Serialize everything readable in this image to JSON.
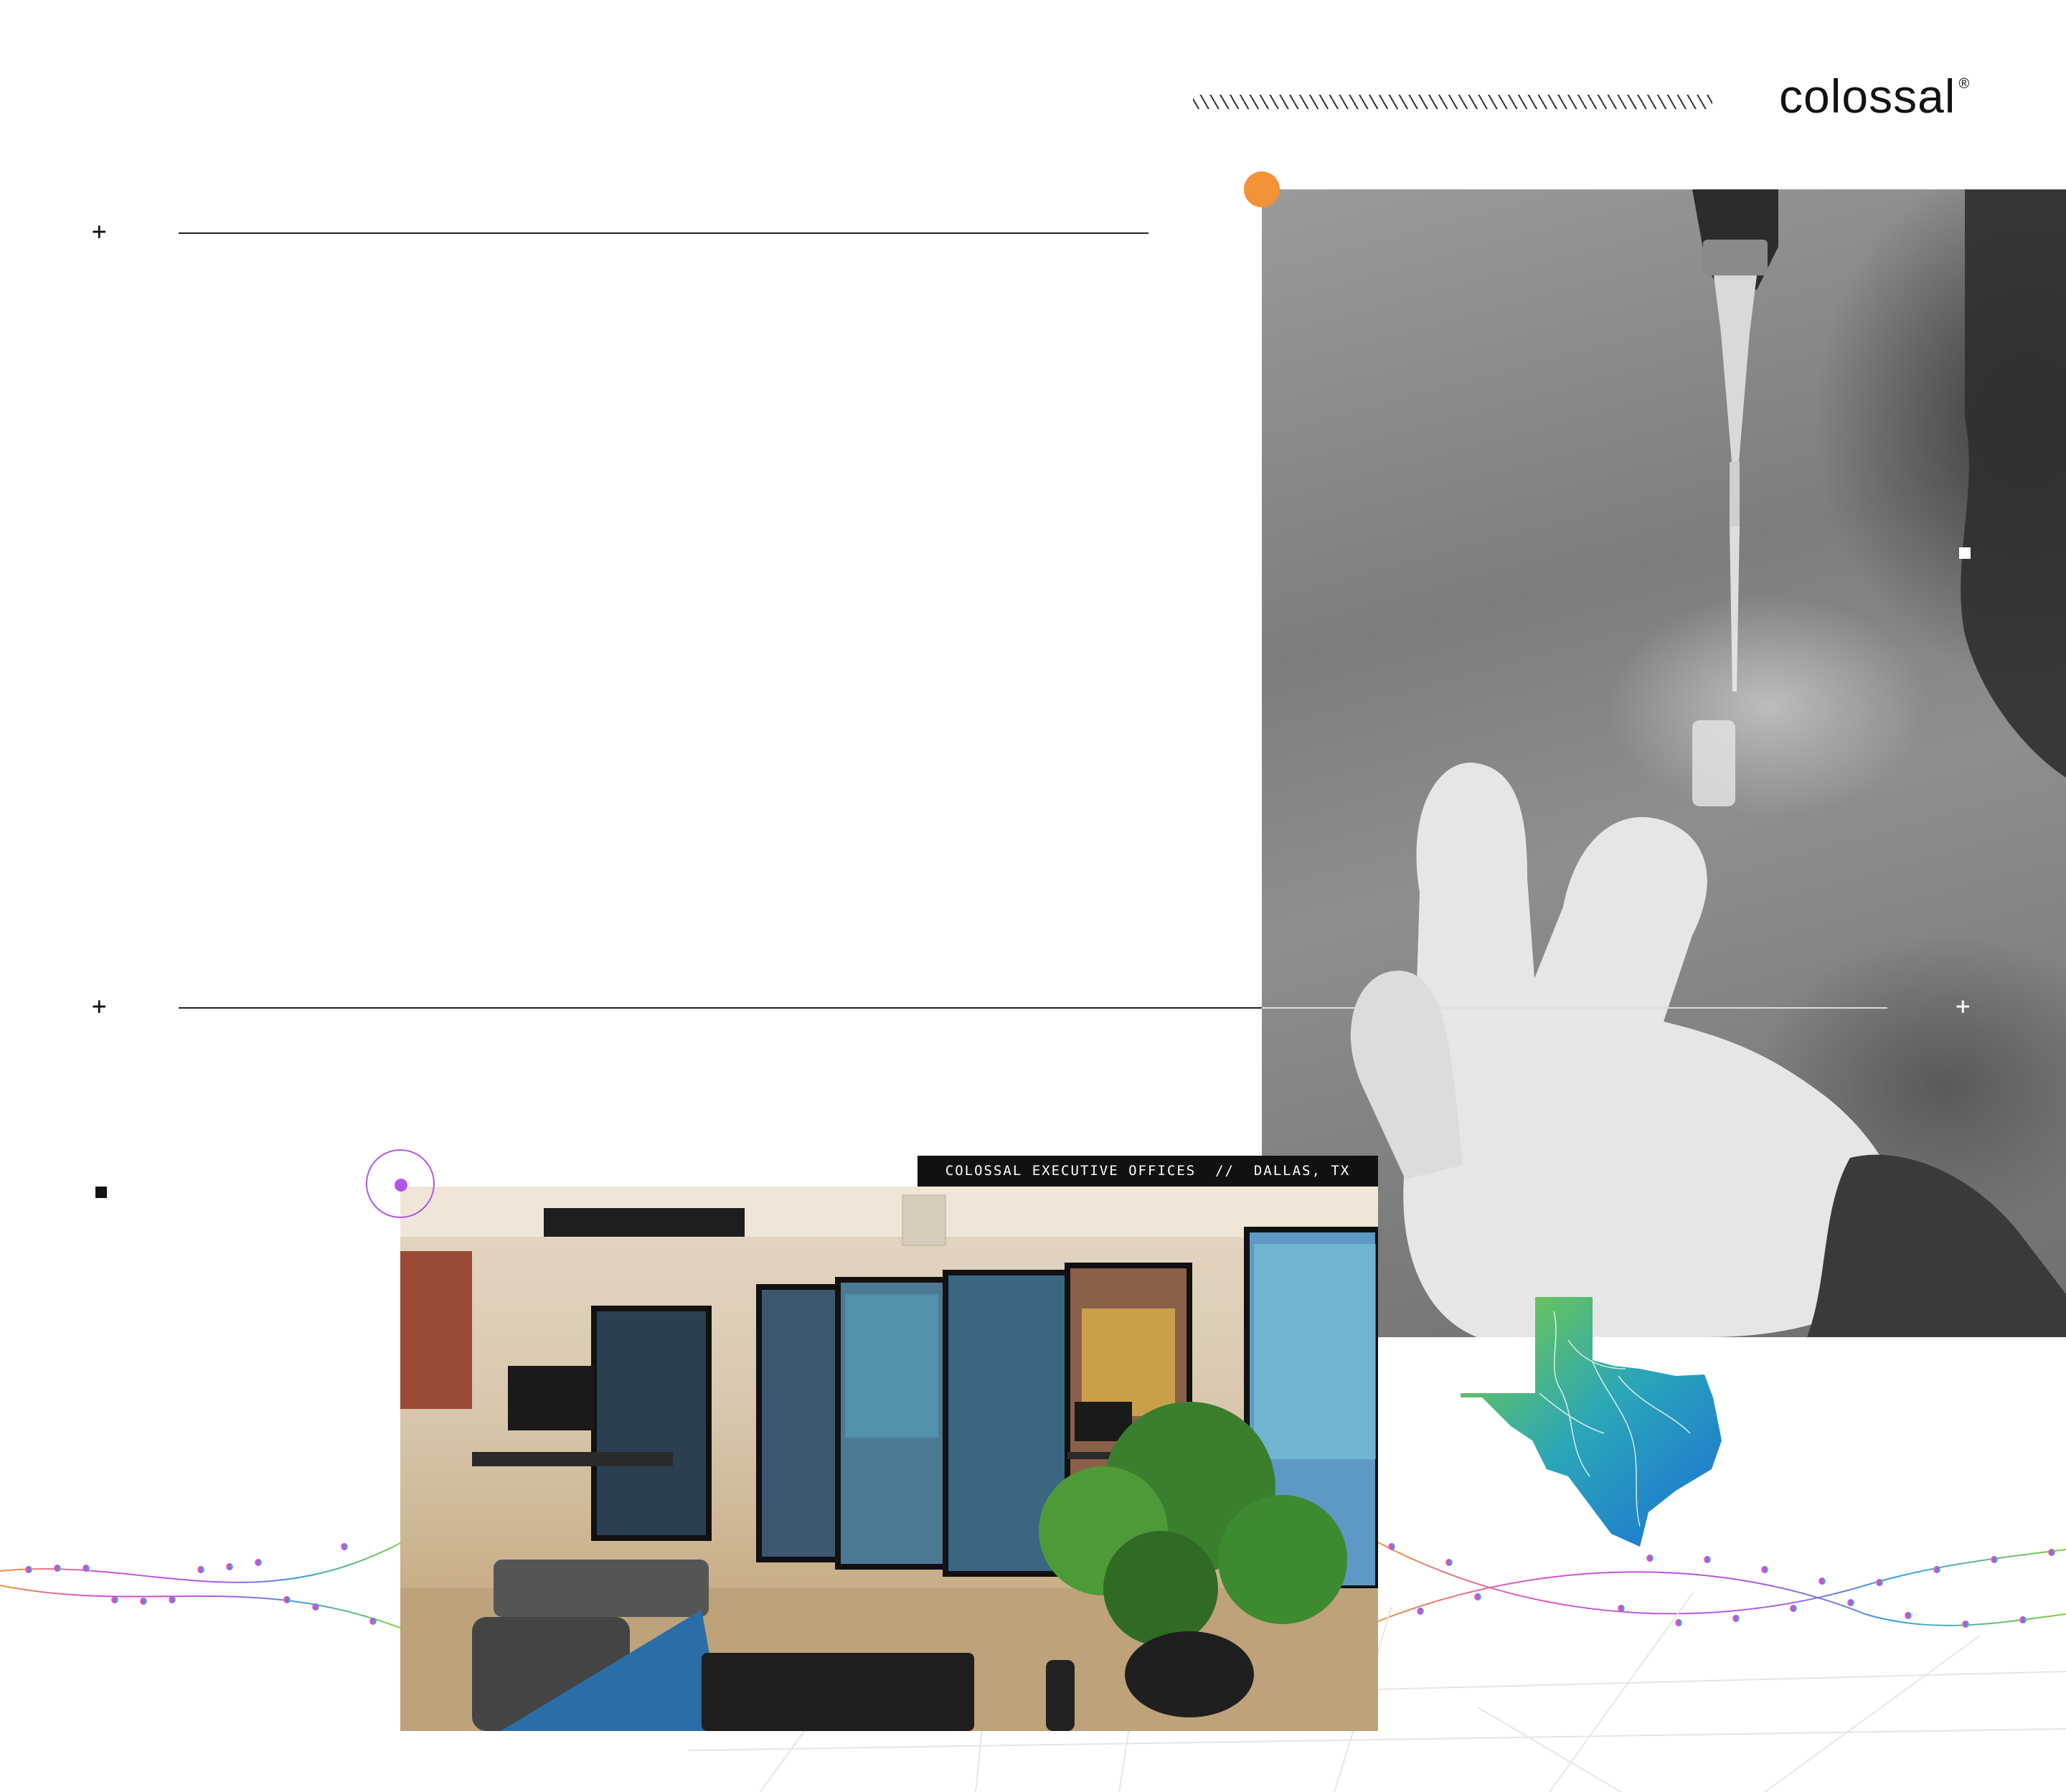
{
  "brand": {
    "name": "colossal",
    "mark": "®"
  },
  "office_caption": "COLOSSAL EXECUTIVE OFFICES  //  DALLAS, TX",
  "colors": {
    "orange_accent": "#f39237",
    "purple_accent": "#b455ea",
    "texas_green": "#5ac23a",
    "texas_blue": "#1b6fd6",
    "rule": "#222222"
  },
  "icons": [
    "plus-icon",
    "square-bullet-icon",
    "texas-map-icon",
    "orange-dot-icon",
    "purple-target-icon"
  ]
}
